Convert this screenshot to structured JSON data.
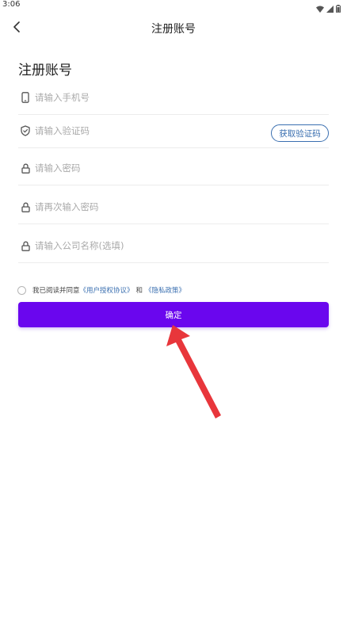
{
  "status_bar": {
    "time": "3:06"
  },
  "app_bar": {
    "back_icon": "chevron-left-icon",
    "title": "注册账号"
  },
  "page": {
    "heading": "注册账号"
  },
  "form": {
    "phone": {
      "icon": "phone-icon",
      "placeholder": "请输入手机号",
      "value": ""
    },
    "code": {
      "icon": "shield-icon",
      "placeholder": "请输入验证码",
      "value": "",
      "get_code_label": "获取验证码"
    },
    "password": {
      "icon": "lock-icon",
      "placeholder": "请输入密码",
      "value": ""
    },
    "password_confirm": {
      "icon": "lock-icon",
      "placeholder": "请再次输入密码",
      "value": ""
    },
    "company": {
      "icon": "lock-icon",
      "placeholder": "请输入公司名称(选填)",
      "value": ""
    }
  },
  "agreement": {
    "prefix": "我已阅读并同意",
    "user_agreement": "《用户授权协议》",
    "conjunction": "和",
    "privacy_policy": "《隐私政策》",
    "checked": false
  },
  "confirm_button": {
    "label": "确定"
  },
  "colors": {
    "primary": "#6a06ee",
    "link": "#3a6fb0",
    "annotation_arrow": "#e8363b"
  }
}
